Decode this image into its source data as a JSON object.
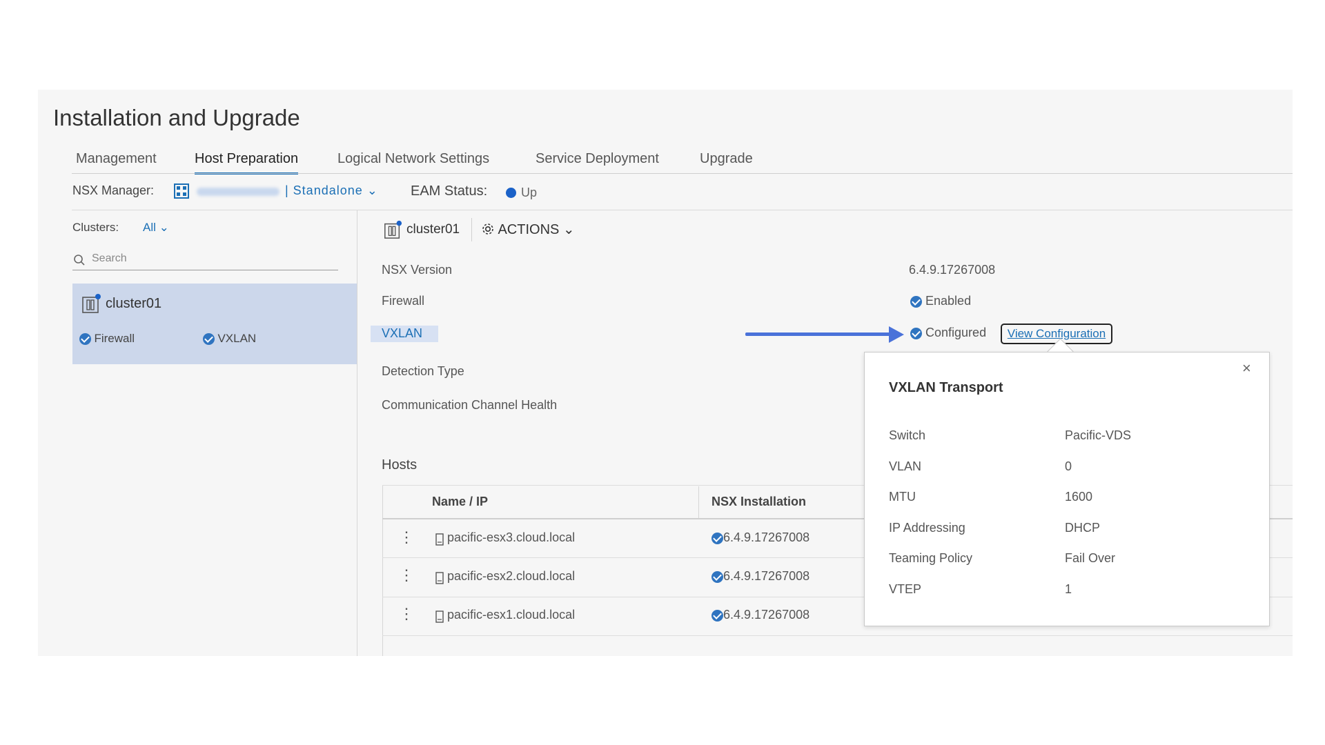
{
  "page": {
    "title": "Installation and Upgrade"
  },
  "tabs": [
    {
      "label": "Management"
    },
    {
      "label": "Host Preparation",
      "active": true
    },
    {
      "label": "Logical Network Settings"
    },
    {
      "label": "Service Deployment"
    },
    {
      "label": "Upgrade"
    }
  ],
  "header": {
    "nsx_manager_label": "NSX Manager:",
    "nsx_manager_mode": "| Standalone ⌄",
    "eam_status_label": "EAM Status:",
    "eam_status_value": "Up",
    "eam_status_color": "#1b62c8"
  },
  "sidebar": {
    "clusters_label": "Clusters:",
    "clusters_filter": "All ⌄",
    "search_placeholder": "Search",
    "cluster": {
      "name": "cluster01",
      "features": [
        "Firewall",
        "VXLAN"
      ]
    }
  },
  "detail": {
    "cluster_name": "cluster01",
    "actions_label": "ACTIONS ⌄",
    "properties": {
      "nsx_version_label": "NSX Version",
      "nsx_version_value": "6.4.9.17267008",
      "firewall_label": "Firewall",
      "firewall_value": "Enabled",
      "vxlan_label": "VXLAN",
      "vxlan_value": "Configured",
      "view_configuration": "View Configuration",
      "detection_type_label": "Detection Type",
      "comm_channel_label": "Communication Channel Health"
    }
  },
  "hosts": {
    "title": "Hosts",
    "columns": [
      "Name / IP",
      "NSX Installation"
    ],
    "rows": [
      {
        "name": "pacific-esx3.cloud.local",
        "nsx": "6.4.9.17267008"
      },
      {
        "name": "pacific-esx2.cloud.local",
        "nsx": "6.4.9.17267008"
      },
      {
        "name": "pacific-esx1.cloud.local",
        "nsx": "6.4.9.17267008"
      }
    ]
  },
  "popover": {
    "title": "VXLAN Transport",
    "close": "×",
    "rows": [
      {
        "key": "Switch",
        "value": "Pacific-VDS"
      },
      {
        "key": "VLAN",
        "value": "0"
      },
      {
        "key": "MTU",
        "value": "1600"
      },
      {
        "key": "IP Addressing",
        "value": "DHCP"
      },
      {
        "key": "Teaming Policy",
        "value": "Fail Over"
      },
      {
        "key": "VTEP",
        "value": "1"
      }
    ]
  },
  "colors": {
    "accent": "#1b6fb5",
    "check": "#2f74c0",
    "arrow": "#4a72d9",
    "selected_card": "#ccd7eb"
  }
}
